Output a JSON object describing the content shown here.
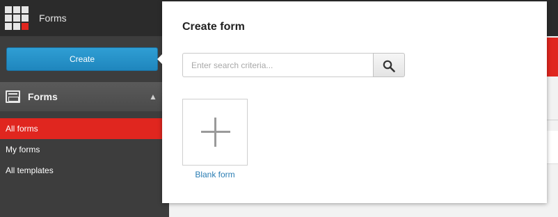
{
  "app": {
    "title": "Forms"
  },
  "sidebar": {
    "create_label": "Create",
    "section_title": "Forms",
    "items": [
      {
        "label": "All forms",
        "active": true
      },
      {
        "label": "My forms",
        "active": false
      },
      {
        "label": "All templates",
        "active": false
      }
    ]
  },
  "popup": {
    "title": "Create form",
    "search": {
      "placeholder": "Enter search criteria...",
      "value": ""
    },
    "tiles": [
      {
        "label": "Blank form",
        "icon": "plus-icon"
      }
    ]
  },
  "colors": {
    "accent_red": "#e0261f",
    "button_blue": "#2a8fc6",
    "link_blue": "#2a7db3"
  }
}
